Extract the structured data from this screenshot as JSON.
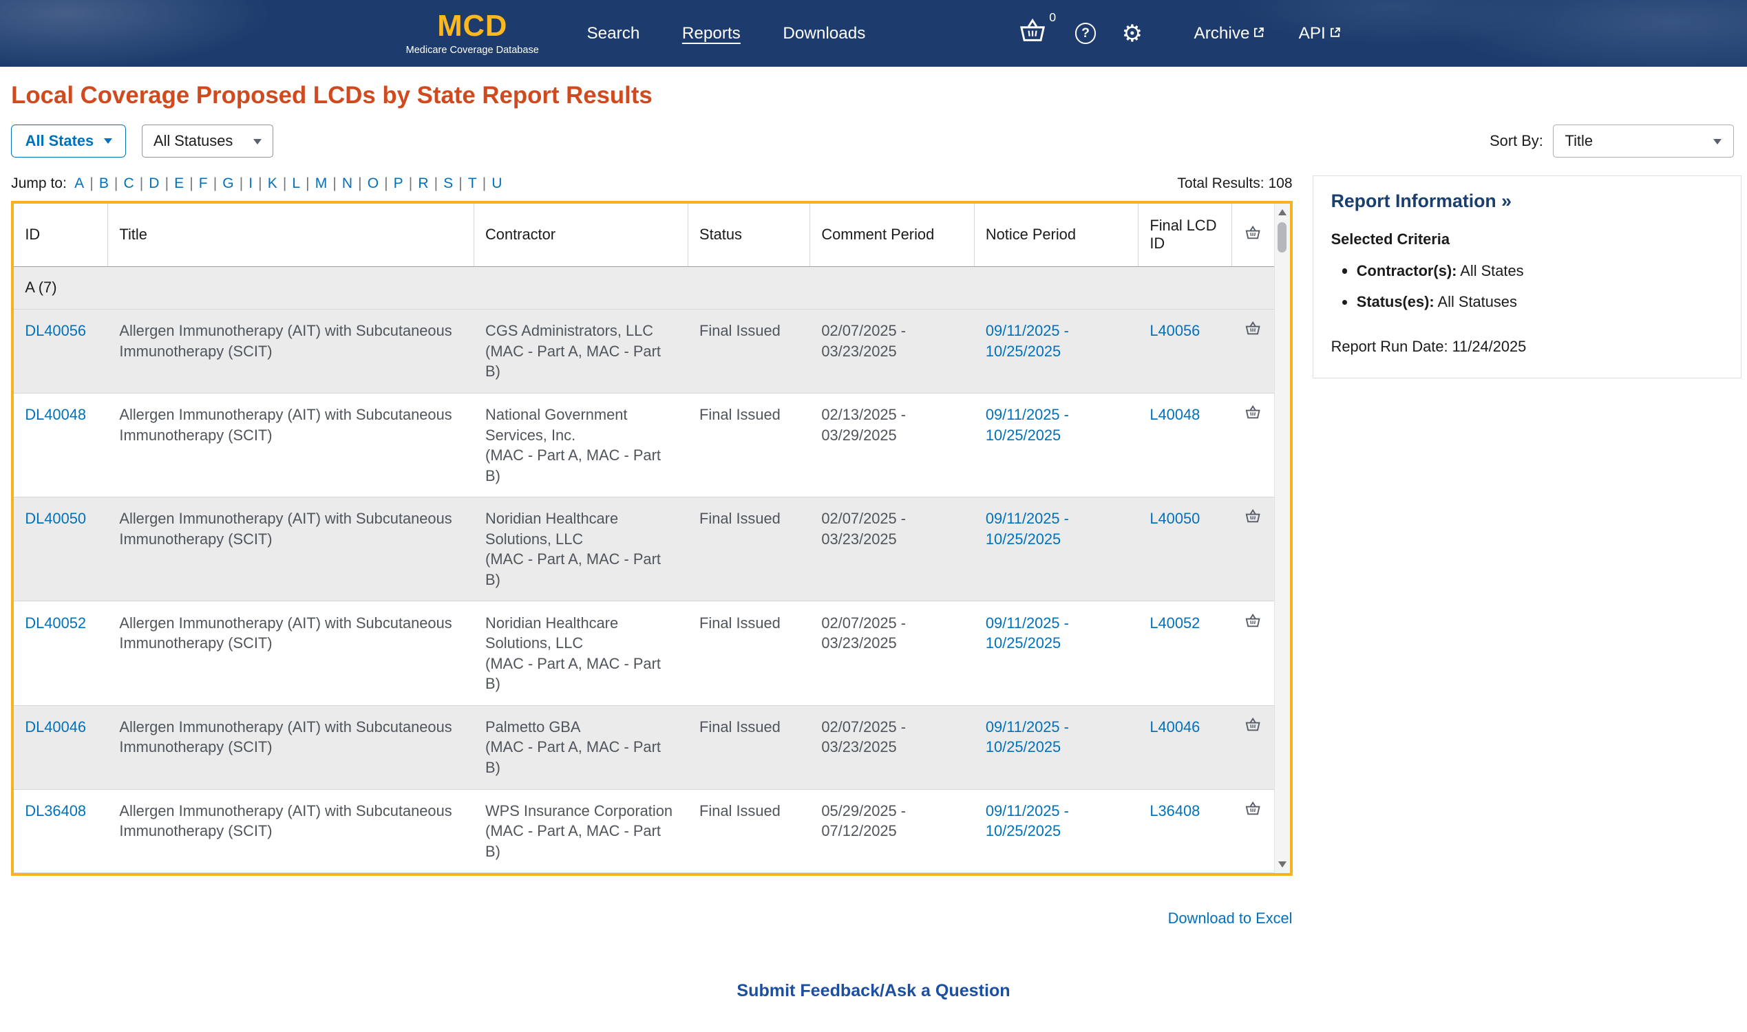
{
  "header": {
    "logo": {
      "title": "MCD",
      "subtitle": "Medicare Coverage Database"
    },
    "nav": [
      {
        "label": "Search"
      },
      {
        "label": "Reports"
      },
      {
        "label": "Downloads"
      }
    ],
    "basket": {
      "count": "0"
    },
    "icons": {
      "help_glyph": "?",
      "gear_glyph": "⚙"
    },
    "archive_label": "Archive",
    "api_label": "API"
  },
  "page": {
    "title": "Local Coverage Proposed LCDs by State Report Results"
  },
  "filters": {
    "states_button": "All States",
    "statuses_select": "All Statuses",
    "sort_by_label": "Sort By:",
    "sort_by_value": "Title"
  },
  "jump": {
    "label": "Jump to:",
    "separator": "|",
    "letters": [
      "A",
      "B",
      "C",
      "D",
      "E",
      "F",
      "G",
      "I",
      "K",
      "L",
      "M",
      "N",
      "O",
      "P",
      "R",
      "S",
      "T",
      "U"
    ]
  },
  "results": {
    "total_label": "Total Results:",
    "total_value": "108"
  },
  "table": {
    "columns": {
      "id": "ID",
      "title": "Title",
      "contractor": "Contractor",
      "status": "Status",
      "comment": "Comment Period",
      "notice": "Notice Period",
      "final": "Final LCD ID"
    },
    "group_header": "A (7)",
    "rows": [
      {
        "id": "DL40056",
        "title": "Allergen Immunotherapy (AIT) with Subcutaneous Immunotherapy (SCIT)",
        "contractor": "CGS Administrators, LLC",
        "contractor_type": "(MAC - Part A, MAC - Part B)",
        "status": "Final Issued",
        "comment": "02/07/2025 - 03/23/2025",
        "notice": "09/11/2025 - 10/25/2025",
        "final": "L40056"
      },
      {
        "id": "DL40048",
        "title": "Allergen Immunotherapy (AIT) with Subcutaneous Immunotherapy (SCIT)",
        "contractor": "National Government Services, Inc.",
        "contractor_type": "(MAC - Part A, MAC - Part B)",
        "status": "Final Issued",
        "comment": "02/13/2025 - 03/29/2025",
        "notice": "09/11/2025 - 10/25/2025",
        "final": "L40048"
      },
      {
        "id": "DL40050",
        "title": "Allergen Immunotherapy (AIT) with Subcutaneous Immunotherapy (SCIT)",
        "contractor": "Noridian Healthcare Solutions, LLC",
        "contractor_type": "(MAC - Part A, MAC - Part B)",
        "status": "Final Issued",
        "comment": "02/07/2025 - 03/23/2025",
        "notice": "09/11/2025 - 10/25/2025",
        "final": "L40050"
      },
      {
        "id": "DL40052",
        "title": "Allergen Immunotherapy (AIT) with Subcutaneous Immunotherapy (SCIT)",
        "contractor": "Noridian Healthcare Solutions, LLC",
        "contractor_type": "(MAC - Part A, MAC - Part B)",
        "status": "Final Issued",
        "comment": "02/07/2025 - 03/23/2025",
        "notice": "09/11/2025 - 10/25/2025",
        "final": "L40052"
      },
      {
        "id": "DL40046",
        "title": "Allergen Immunotherapy (AIT) with Subcutaneous Immunotherapy (SCIT)",
        "contractor": "Palmetto GBA",
        "contractor_type": "(MAC - Part A, MAC - Part B)",
        "status": "Final Issued",
        "comment": "02/07/2025 - 03/23/2025",
        "notice": "09/11/2025 - 10/25/2025",
        "final": "L40046"
      },
      {
        "id": "DL36408",
        "title": "Allergen Immunotherapy (AIT) with Subcutaneous Immunotherapy (SCIT)",
        "contractor": "WPS Insurance Corporation",
        "contractor_type": "(MAC - Part A, MAC - Part B)",
        "status": "Final Issued",
        "comment": "05/29/2025 - 07/12/2025",
        "notice": "09/11/2025 - 10/25/2025",
        "final": "L36408"
      }
    ]
  },
  "sidebar": {
    "title": "Report Information »",
    "criteria_heading": "Selected Criteria",
    "criteria": [
      {
        "label": "Contractor(s):",
        "value": "All States"
      },
      {
        "label": "Status(es):",
        "value": "All Statuses"
      }
    ],
    "run_date_label": "Report Run Date:",
    "run_date_value": "11/24/2025"
  },
  "footer": {
    "download_label": "Download to Excel",
    "feedback_label": "Submit Feedback/Ask a Question"
  }
}
